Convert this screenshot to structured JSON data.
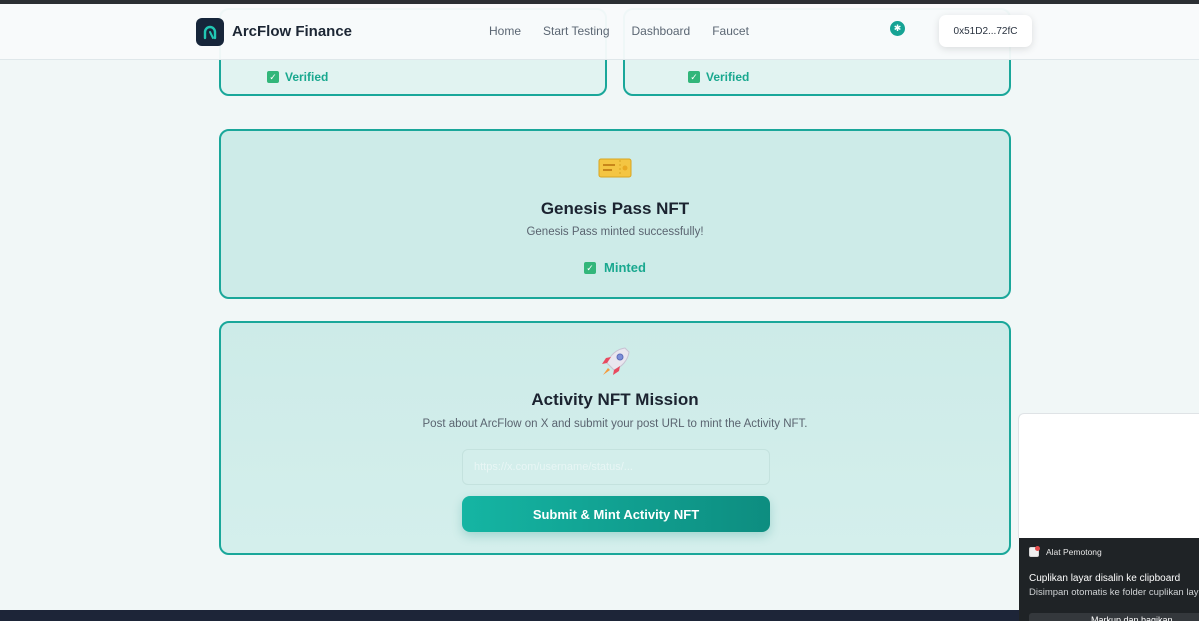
{
  "header": {
    "brand": "ArcFlow Finance",
    "nav": [
      "Home",
      "Start Testing",
      "Dashboard",
      "Faucet"
    ],
    "wallet": "0x51D2...72fC"
  },
  "top_cards": [
    {
      "status": "Verified"
    },
    {
      "status": "Verified"
    }
  ],
  "genesis": {
    "icon": "ticket-icon",
    "title": "Genesis Pass NFT",
    "description": "Genesis Pass minted successfully!",
    "status": "Minted"
  },
  "activity": {
    "icon": "rocket-icon",
    "title": "Activity NFT Mission",
    "description": "Post about ArcFlow on X and submit your post URL to mint the Activity NFT.",
    "url_placeholder": "https://x.com/username/status/...",
    "button": "Submit & Mint Activity NFT"
  },
  "toast": {
    "app": "Alat Pemotong",
    "title": "Cuplikan layar disalin ke clipboard",
    "subtitle": "Disimpan otomatis ke folder cuplikan lay",
    "button": "Markup dan bagikan"
  },
  "colors": {
    "accent": "#1aa79a",
    "card_bg": "#cdebe8",
    "success": "#19a88f",
    "button_gradient_start": "#15b5a3",
    "button_gradient_end": "#0d8d80"
  }
}
